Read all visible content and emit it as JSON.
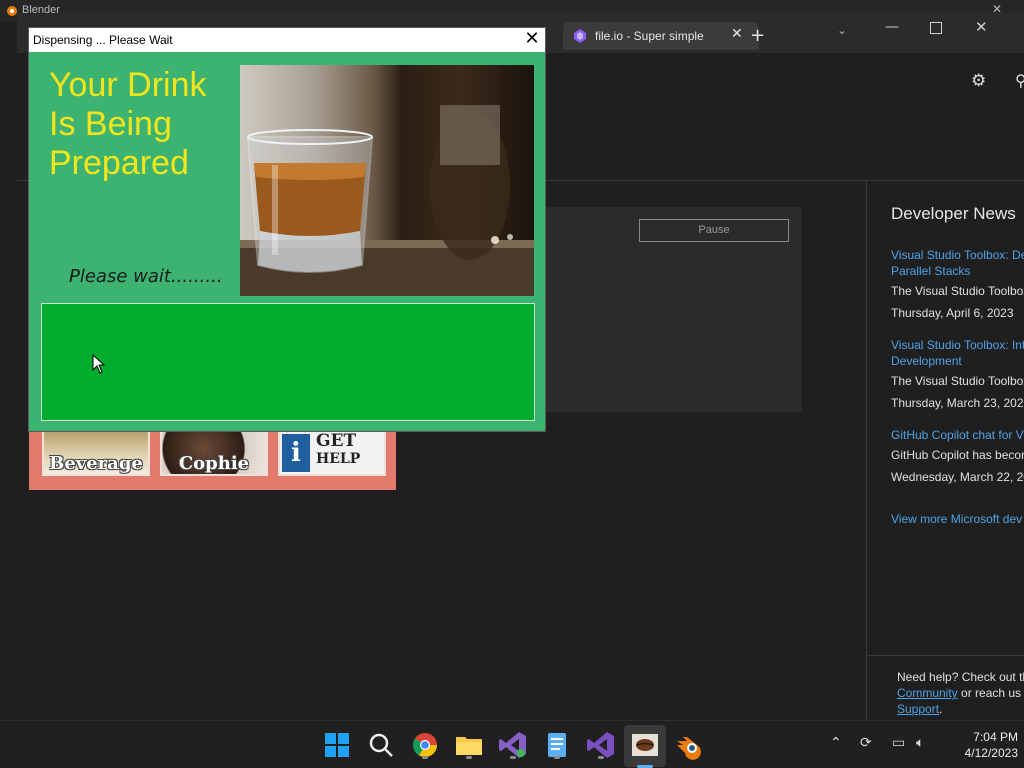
{
  "background_app": {
    "title": "Blender"
  },
  "browser_tabs": {
    "tab_fileio_label": "file.io - Super simple"
  },
  "control_panel": {
    "pause_label": "Pause"
  },
  "developer_news": {
    "title": "Developer News",
    "items": [
      {
        "link": "Visual Studio Toolbox: De",
        "link2": "Parallel Stacks",
        "text": "The Visual Studio Toolbox",
        "date": "Thursday, April 6, 2023"
      },
      {
        "link": "Visual Studio Toolbox: Int",
        "link2": "Development",
        "text": "The Visual Studio Toolbox",
        "date": "Thursday, March 23, 2023"
      },
      {
        "link": "GitHub Copilot chat for V",
        "link2": "",
        "text": "GitHub Copilot has becor",
        "date": "Wednesday, March 22, 20"
      }
    ],
    "more_link": "View more Microsoft dev",
    "help": {
      "line1": "Need help? Check out th",
      "community": "Community",
      "reach": " or reach us",
      "support": "Support",
      "period": "."
    }
  },
  "coffee_app": {
    "buttons": {
      "beverage": "Beverage",
      "coffee": "Cophie",
      "help_line1": "GET",
      "help_line2": "HELP",
      "help_i": "i"
    }
  },
  "dialog": {
    "title": "Dispensing ... Please Wait",
    "close_glyph": "✕",
    "headline": [
      "Your Drink",
      "Is Being",
      "Prepared"
    ],
    "wait_text": "Please wait.........",
    "colors": {
      "background": "#3cb371",
      "headline": "#f2e51c",
      "progress": "#00ab2d"
    }
  },
  "taskbar": {
    "icons": [
      "start-icon",
      "search-icon",
      "chrome-icon",
      "file-explorer-icon",
      "visual-studio-preview-icon",
      "notepad-icon",
      "visual-studio-icon",
      "coffee-app-icon",
      "blender-icon"
    ],
    "clock": {
      "time": "7:04 PM",
      "date": "4/12/2023"
    }
  }
}
